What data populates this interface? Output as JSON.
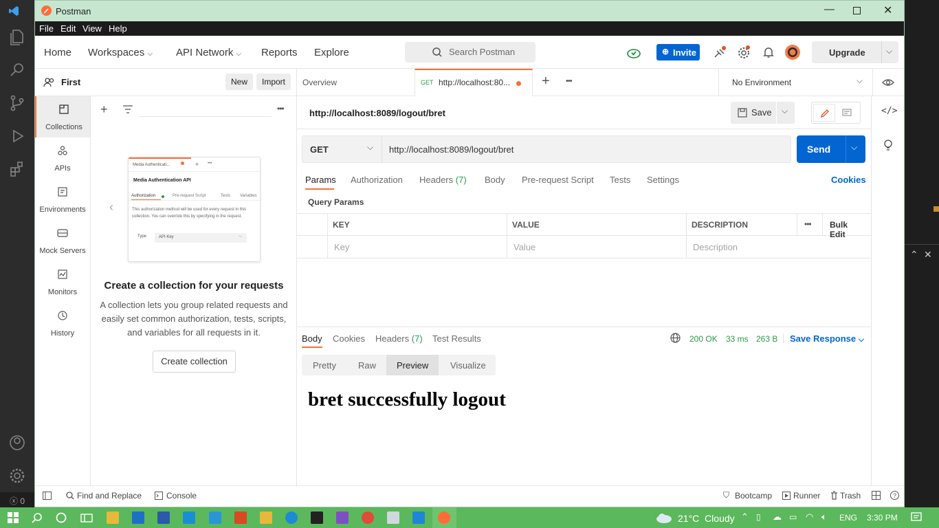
{
  "window": {
    "title": "Postman"
  },
  "menu": [
    "File",
    "Edit",
    "View",
    "Help"
  ],
  "header": {
    "nav": [
      "Home",
      "Workspaces",
      "API Network",
      "Reports",
      "Explore"
    ],
    "search_placeholder": "Search Postman",
    "invite_label": "Invite",
    "upgrade_label": "Upgrade"
  },
  "workspace": {
    "name": "First",
    "new_label": "New",
    "import_label": "Import"
  },
  "rail": [
    "Collections",
    "APIs",
    "Environments",
    "Mock Servers",
    "Monitors",
    "History"
  ],
  "empty_state": {
    "preview_tab": "Media Authenticati...",
    "preview_title": "Media Authentication API",
    "preview_tabs": [
      "Authorization",
      "Pre-request Script",
      "Tests",
      "Variables"
    ],
    "preview_text": "This authorization method will be used for every request in this collection. You can override this by specifying in the request.",
    "preview_type_label": "Type",
    "preview_type_value": "API Key",
    "title": "Create a collection for your requests",
    "description": "A collection lets you group related requests and easily set common authorization, tests, scripts, and variables for all requests in it.",
    "button": "Create collection"
  },
  "tabs": {
    "overview": "Overview",
    "active_method": "GET",
    "active_label": "http://localhost:80...",
    "environment": "No Environment"
  },
  "request": {
    "name": "http://localhost:8089/logout/bret",
    "save_label": "Save",
    "method": "GET",
    "url": "http://localhost:8089/logout/bret",
    "send_label": "Send",
    "subtabs": [
      "Params",
      "Authorization",
      "Headers",
      "Body",
      "Pre-request Script",
      "Tests",
      "Settings"
    ],
    "headers_count": "(7)",
    "cookies_label": "Cookies",
    "query_params_label": "Query Params",
    "table_headers": [
      "KEY",
      "VALUE",
      "DESCRIPTION"
    ],
    "bulk_edit": "Bulk Edit",
    "placeholders": [
      "Key",
      "Value",
      "Description"
    ]
  },
  "response": {
    "tabs": [
      "Body",
      "Cookies",
      "Headers",
      "Test Results"
    ],
    "headers_count": "(7)",
    "status": "200 OK",
    "time": "33 ms",
    "size": "263 B",
    "save_response": "Save Response",
    "views": [
      "Pretty",
      "Raw",
      "Preview",
      "Visualize"
    ],
    "active_view": "Preview",
    "preview_html": "bret successfully logout"
  },
  "footer": {
    "find_replace": "Find and Replace",
    "console": "Console",
    "bootcamp": "Bootcamp",
    "runner": "Runner",
    "trash": "Trash"
  },
  "taskbar": {
    "weather": "21°C  Cloudy",
    "lang": "ENG",
    "time": "3:30 PM"
  },
  "vscode_status": "0"
}
